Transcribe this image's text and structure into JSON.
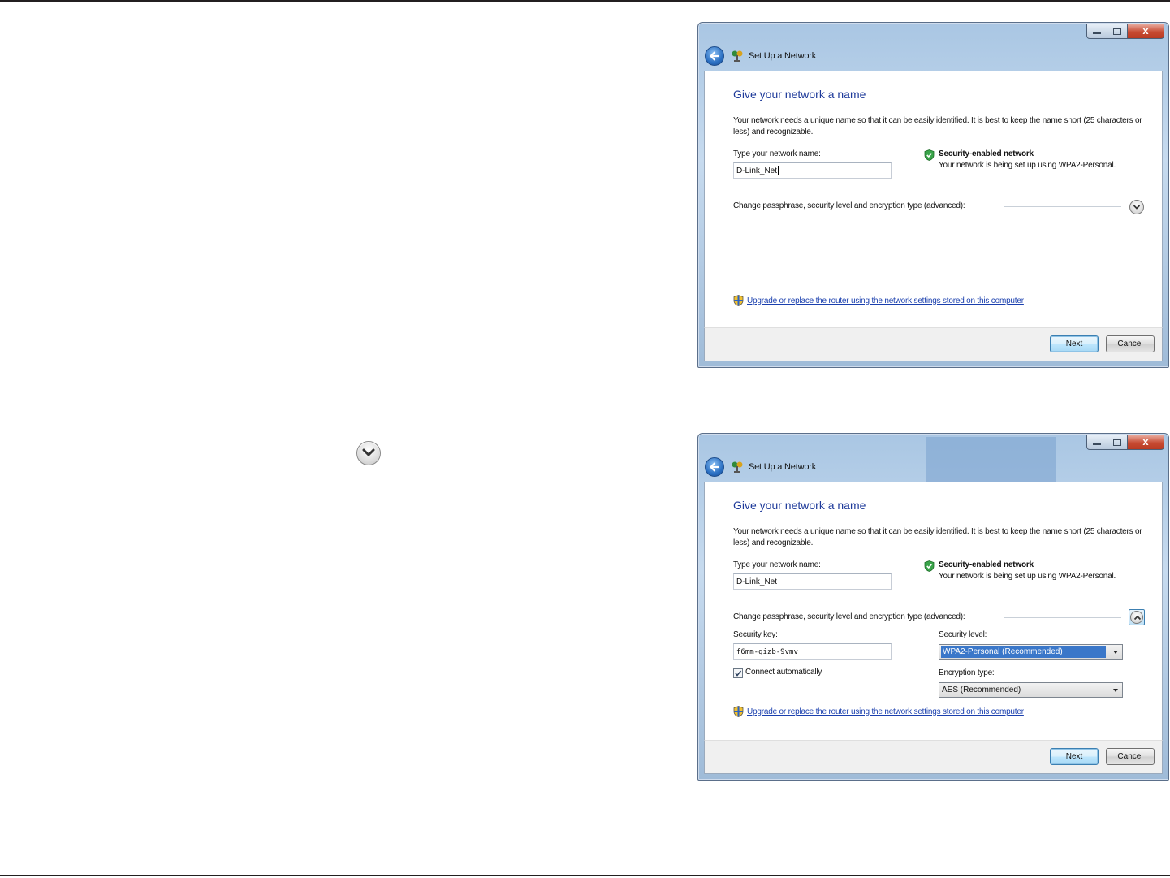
{
  "dialogs": [
    {
      "title": "Set Up a Network",
      "heading": "Give your network a name",
      "description": "Your network needs a unique name so that it can be easily identified. It is best to keep the name short (25 characters or less) and recognizable.",
      "name_label": "Type your network name:",
      "name_value": "D-Link_Net",
      "security_title": "Security-enabled network",
      "security_subtitle": "Your network is being set up using WPA2-Personal.",
      "advanced_label": "Change passphrase, security level and encryption type (advanced):",
      "advanced_expanded": false,
      "upgrade_link": "Upgrade or replace the router using the network settings stored on this computer",
      "next_label": "Next",
      "cancel_label": "Cancel",
      "close_glyph": "x"
    },
    {
      "title": "Set Up a Network",
      "heading": "Give your network a name",
      "description": "Your network needs a unique name so that it can be easily identified. It is best to keep the name short (25 characters or less) and recognizable.",
      "name_label": "Type your network name:",
      "name_value": "D-Link_Net",
      "security_title": "Security-enabled network",
      "security_subtitle": "Your network is being set up using WPA2-Personal.",
      "advanced_label": "Change passphrase, security level and encryption type (advanced):",
      "advanced_expanded": true,
      "security_key_label": "Security key:",
      "security_key_value": "f6mm-gizb-9vmv",
      "connect_auto_label": "Connect automatically",
      "connect_auto_checked": true,
      "security_level_label": "Security level:",
      "security_level_value": "WPA2-Personal (Recommended)",
      "encryption_type_label": "Encryption type:",
      "encryption_type_value": "AES (Recommended)",
      "upgrade_link": "Upgrade or replace the router using the network settings stored on this computer",
      "next_label": "Next",
      "cancel_label": "Cancel",
      "close_glyph": "x"
    }
  ],
  "side_icon": "chevron-down-icon",
  "colors": {
    "heading": "#1e3a9a",
    "link": "#1a3fae",
    "close_button": "#c74b33",
    "rule": "#231f20"
  }
}
